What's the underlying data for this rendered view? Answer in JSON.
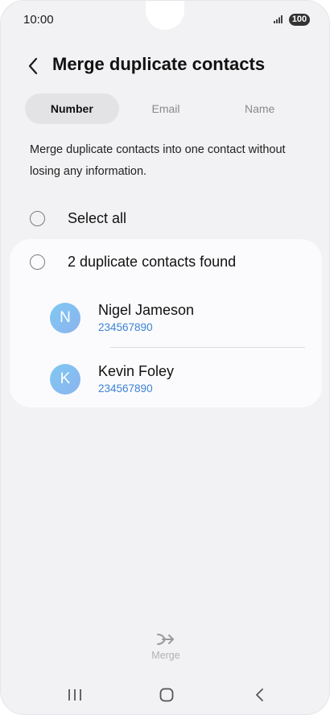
{
  "status": {
    "time": "10:00",
    "battery": "100"
  },
  "header": {
    "title": "Merge duplicate contacts"
  },
  "tabs": [
    {
      "label": "Number",
      "active": true
    },
    {
      "label": "Email",
      "active": false
    },
    {
      "label": "Name",
      "active": false
    }
  ],
  "description": "Merge duplicate contacts into one contact without losing any information.",
  "select_all_label": "Select all",
  "group": {
    "label": "2 duplicate contacts found",
    "contacts": [
      {
        "initial": "N",
        "name": "Nigel Jameson",
        "number": "234567890"
      },
      {
        "initial": "K",
        "name": "Kevin Foley",
        "number": "234567890"
      }
    ]
  },
  "actions": {
    "merge_label": "Merge"
  },
  "colors": {
    "accent_link": "#3c82d4",
    "avatar": "#7fc9f2",
    "background": "#f2f2f4",
    "card": "#fbfbfd"
  }
}
